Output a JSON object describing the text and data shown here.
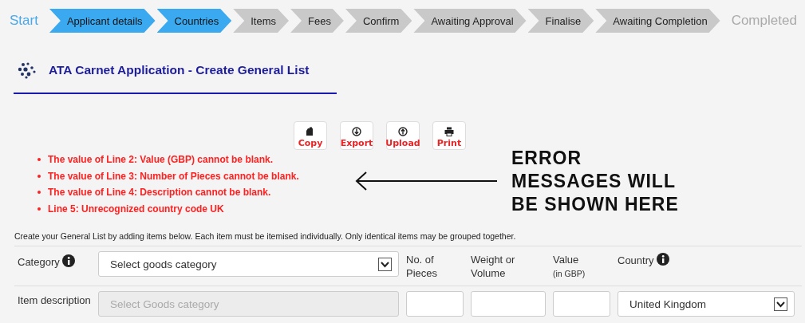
{
  "steps": [
    {
      "kind": "start",
      "label": "Start"
    },
    {
      "kind": "step",
      "label": "Applicant details",
      "complete": true
    },
    {
      "kind": "step",
      "label": "Countries",
      "complete": true
    },
    {
      "kind": "step",
      "label": "Items",
      "complete": false
    },
    {
      "kind": "step",
      "label": "Fees",
      "complete": false
    },
    {
      "kind": "step",
      "label": "Confirm",
      "complete": false
    },
    {
      "kind": "step",
      "label": "Awaiting Approval",
      "complete": false
    },
    {
      "kind": "step",
      "label": "Finalise",
      "complete": false
    },
    {
      "kind": "step",
      "label": "Awaiting Completion",
      "complete": false
    },
    {
      "kind": "end",
      "label": "Completed"
    }
  ],
  "page_title": "ATA Carnet Application - Create General List",
  "toolbar": [
    {
      "kind": "copy",
      "label": "Copy"
    },
    {
      "kind": "export",
      "label": "Export"
    },
    {
      "kind": "upload",
      "label": "Upload"
    },
    {
      "kind": "print",
      "label": "Print"
    }
  ],
  "errors": [
    "The value of Line 2: Value (GBP) cannot be blank.",
    "The value of Line 3: Number of Pieces cannot be blank.",
    "The value of Line 4: Description cannot be blank.",
    "Line 5: Unrecognized country code UK"
  ],
  "annotation": [
    "ERROR",
    "MESSAGES WILL",
    "BE SHOWN HERE"
  ],
  "instructions": "Create your General List by adding items below. Each item must be itemised individually. Only identical items may be grouped together.",
  "form": {
    "category": {
      "label": "Category",
      "info": true,
      "placeholder": "Select goods category"
    },
    "headers": [
      {
        "label": "No. of Pieces"
      },
      {
        "label": "Weight or Volume"
      },
      {
        "label": "Value",
        "sublabel": "(in GBP)"
      },
      {
        "label": "Country",
        "info": true
      }
    ],
    "description": {
      "label": "Item description",
      "placeholder": "Select Goods category",
      "disabled": true
    },
    "country": {
      "value": "United Kingdom"
    }
  }
}
